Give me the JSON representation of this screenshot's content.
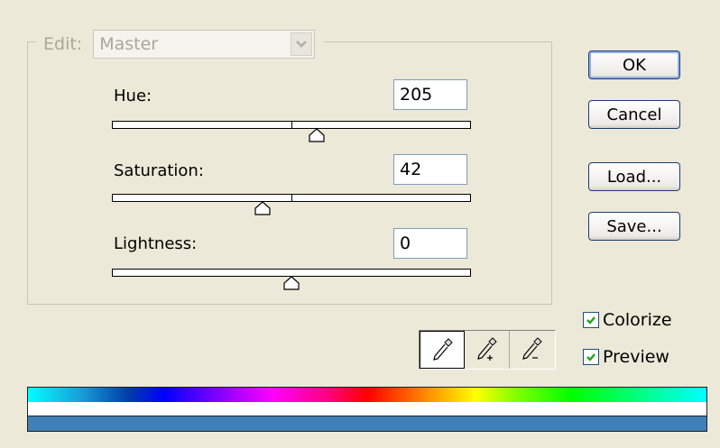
{
  "edit": {
    "label": "Edit:",
    "value": "Master"
  },
  "hue": {
    "label": "Hue:",
    "value": "205",
    "slider_fraction": 0.57
  },
  "saturation": {
    "label": "Saturation:",
    "value": "42",
    "slider_fraction": 0.42
  },
  "lightness": {
    "label": "Lightness:",
    "value": "0",
    "slider_fraction": 0.5
  },
  "buttons": {
    "ok": "OK",
    "cancel": "Cancel",
    "load": "Load...",
    "save": "Save..."
  },
  "options": {
    "colorize": {
      "label": "Colorize",
      "checked": true
    },
    "preview": {
      "label": "Preview",
      "checked": true
    }
  },
  "icons": [
    "eyedropper-icon",
    "eyedropper-plus-icon",
    "eyedropper-minus-icon"
  ],
  "colors": {
    "result_color": "#3f80b7",
    "accent_border": "#7f9db9",
    "checkmark": "#21a121"
  }
}
